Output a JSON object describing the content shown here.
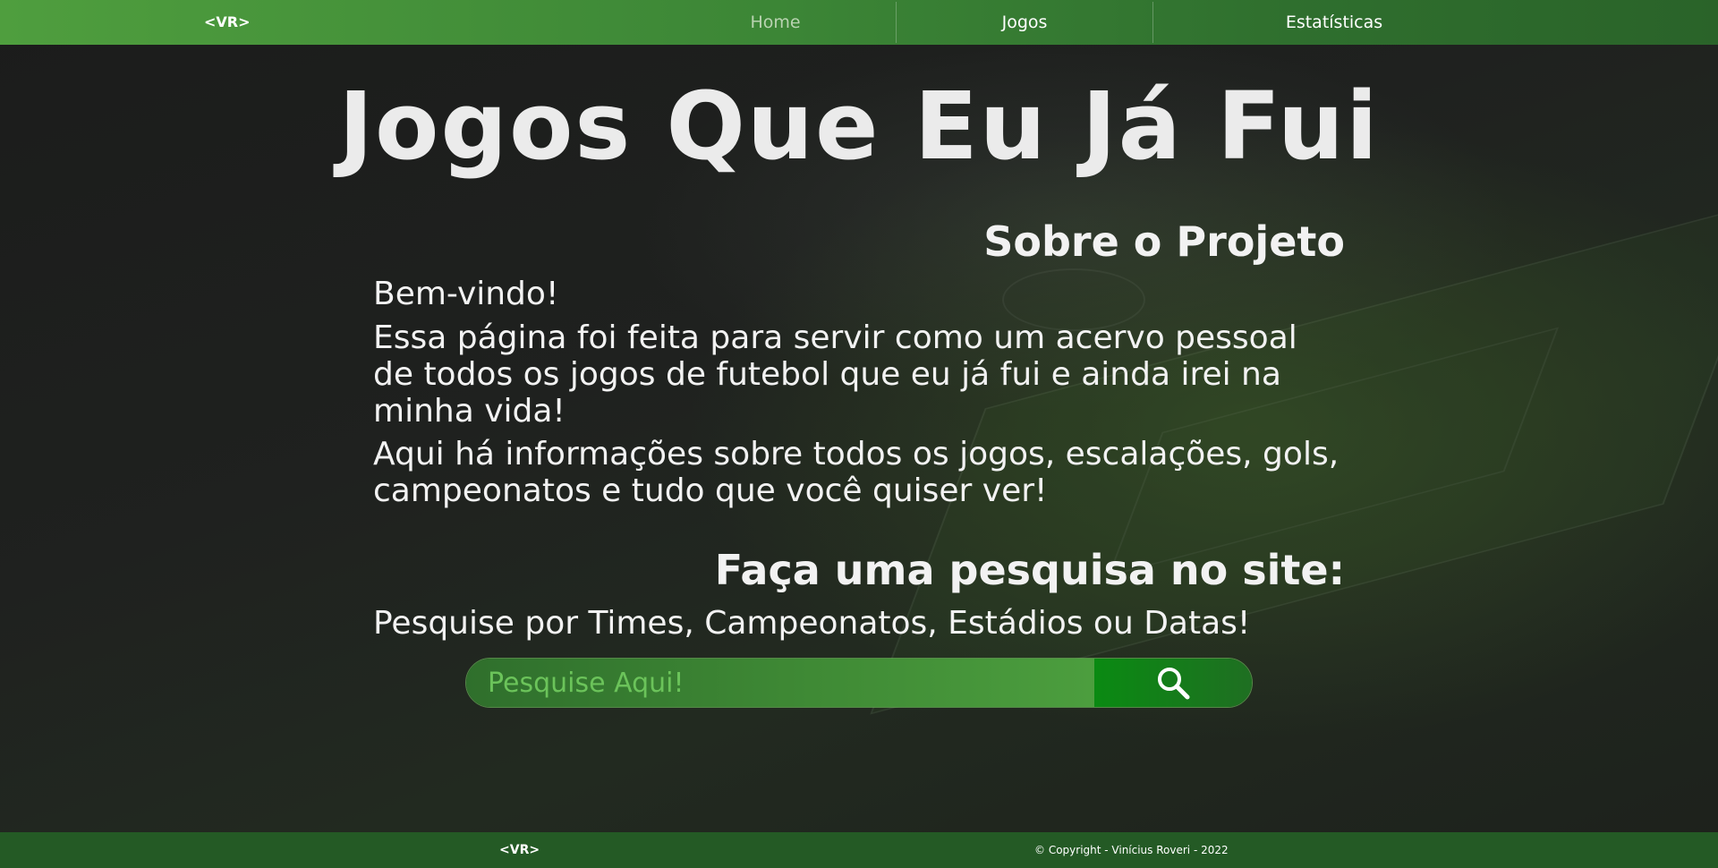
{
  "header": {
    "logo": "<VR>",
    "nav": [
      {
        "label": "Home",
        "active": true
      },
      {
        "label": "Jogos",
        "active": false
      },
      {
        "label": "Estatísticas",
        "active": false
      }
    ],
    "color": "#3c8636"
  },
  "hero": {
    "title": "Jogos Que Eu Já Fui"
  },
  "about": {
    "title": "Sobre o Projeto",
    "welcome": "Bem-vindo!",
    "paragraph1": "Essa página foi feita para servir como um acervo pessoal de todos os jogos de futebol que eu já fui e ainda irei na minha vida!",
    "paragraph2": "Aqui há informações sobre todos os jogos, escalações, gols, campeonatos e tudo que você quiser ver!"
  },
  "search": {
    "title": "Faça uma pesquisa no site:",
    "hint": "Pesquise por Times, Campeonatos, Estádios ou Datas!",
    "placeholder": "Pesquise Aqui!",
    "value": "",
    "button_icon": "search-icon"
  },
  "footer": {
    "logo": "<VR>",
    "copyright": "© Copyright - Vinícius Roveri - 2022",
    "color": "#245a25"
  }
}
